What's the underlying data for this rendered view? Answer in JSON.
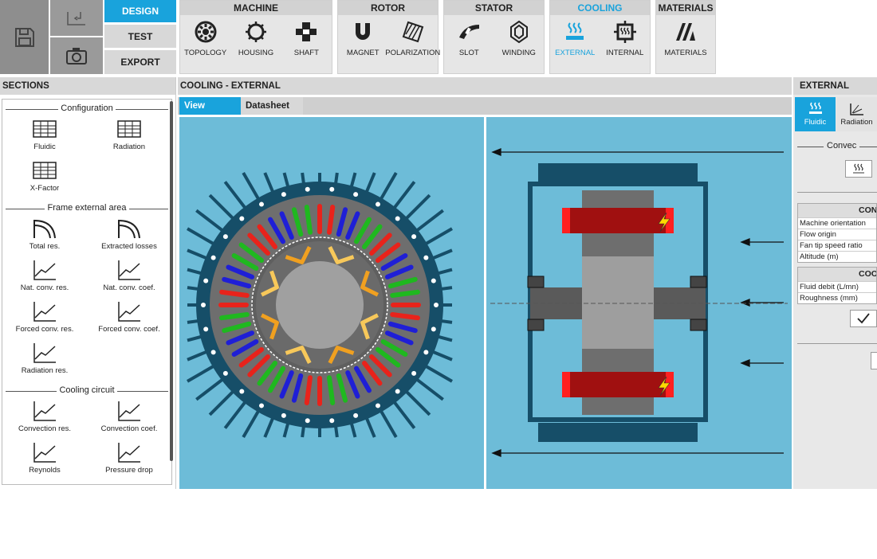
{
  "toolbar": {
    "save_icon": "save-icon",
    "undo_icon": "undo-icon",
    "snapshot_icon": "camera-icon",
    "modes": [
      "DESIGN",
      "TEST",
      "EXPORT"
    ],
    "active_mode": "DESIGN"
  },
  "ribbon": [
    {
      "title": "MACHINE",
      "items": [
        {
          "label": "TOPOLOGY",
          "icon": "topology-icon"
        },
        {
          "label": "HOUSING",
          "icon": "housing-icon"
        },
        {
          "label": "SHAFT",
          "icon": "shaft-icon"
        }
      ]
    },
    {
      "title": "ROTOR",
      "items": [
        {
          "label": "MAGNET",
          "icon": "magnet-icon"
        },
        {
          "label": "POLARIZATION",
          "icon": "polarization-icon"
        }
      ]
    },
    {
      "title": "STATOR",
      "items": [
        {
          "label": "SLOT",
          "icon": "slot-icon"
        },
        {
          "label": "WINDING",
          "icon": "winding-icon"
        }
      ]
    },
    {
      "title": "COOLING",
      "items": [
        {
          "label": "EXTERNAL",
          "icon": "external-cooling-icon"
        },
        {
          "label": "INTERNAL",
          "icon": "internal-cooling-icon"
        }
      ]
    },
    {
      "title": "MATERIALS",
      "items": [
        {
          "label": "MATERIALS",
          "icon": "materials-icon"
        }
      ]
    }
  ],
  "sections": {
    "title": "SECTIONS",
    "groups": [
      {
        "title": "Configuration",
        "items": [
          "Fluidic",
          "Radiation",
          "X-Factor"
        ]
      },
      {
        "title": "Frame external area",
        "items": [
          "Total res.",
          "Extracted losses",
          "Nat. conv. res.",
          "Nat. conv. coef.",
          "Forced conv. res.",
          "Forced conv. coef.",
          "Radiation res."
        ]
      },
      {
        "title": "Cooling circuit",
        "items": [
          "Convection res.",
          "Convection coef.",
          "Reynolds",
          "Pressure drop"
        ]
      }
    ]
  },
  "center": {
    "title": "COOLING - EXTERNAL",
    "tabs": [
      "View",
      "Datasheet"
    ],
    "active_tab": "View"
  },
  "right": {
    "title": "EXTERNAL",
    "tabs": [
      "Fluidic",
      "Radiation"
    ],
    "section": "Convec",
    "table1": {
      "header": "CON",
      "rows": [
        "Machine orientation",
        "Flow origin",
        "Fan tip speed ratio",
        "Altitude (m)"
      ]
    },
    "table2": {
      "header": "COOLI",
      "rows": [
        "Fluid debit (L/mn)",
        "Roughness (mm)"
      ]
    }
  },
  "colors": {
    "accent": "#19a3dc",
    "viewport": "#6dbcd8",
    "frame": "#164e68",
    "stator": "#6e6e6e"
  }
}
